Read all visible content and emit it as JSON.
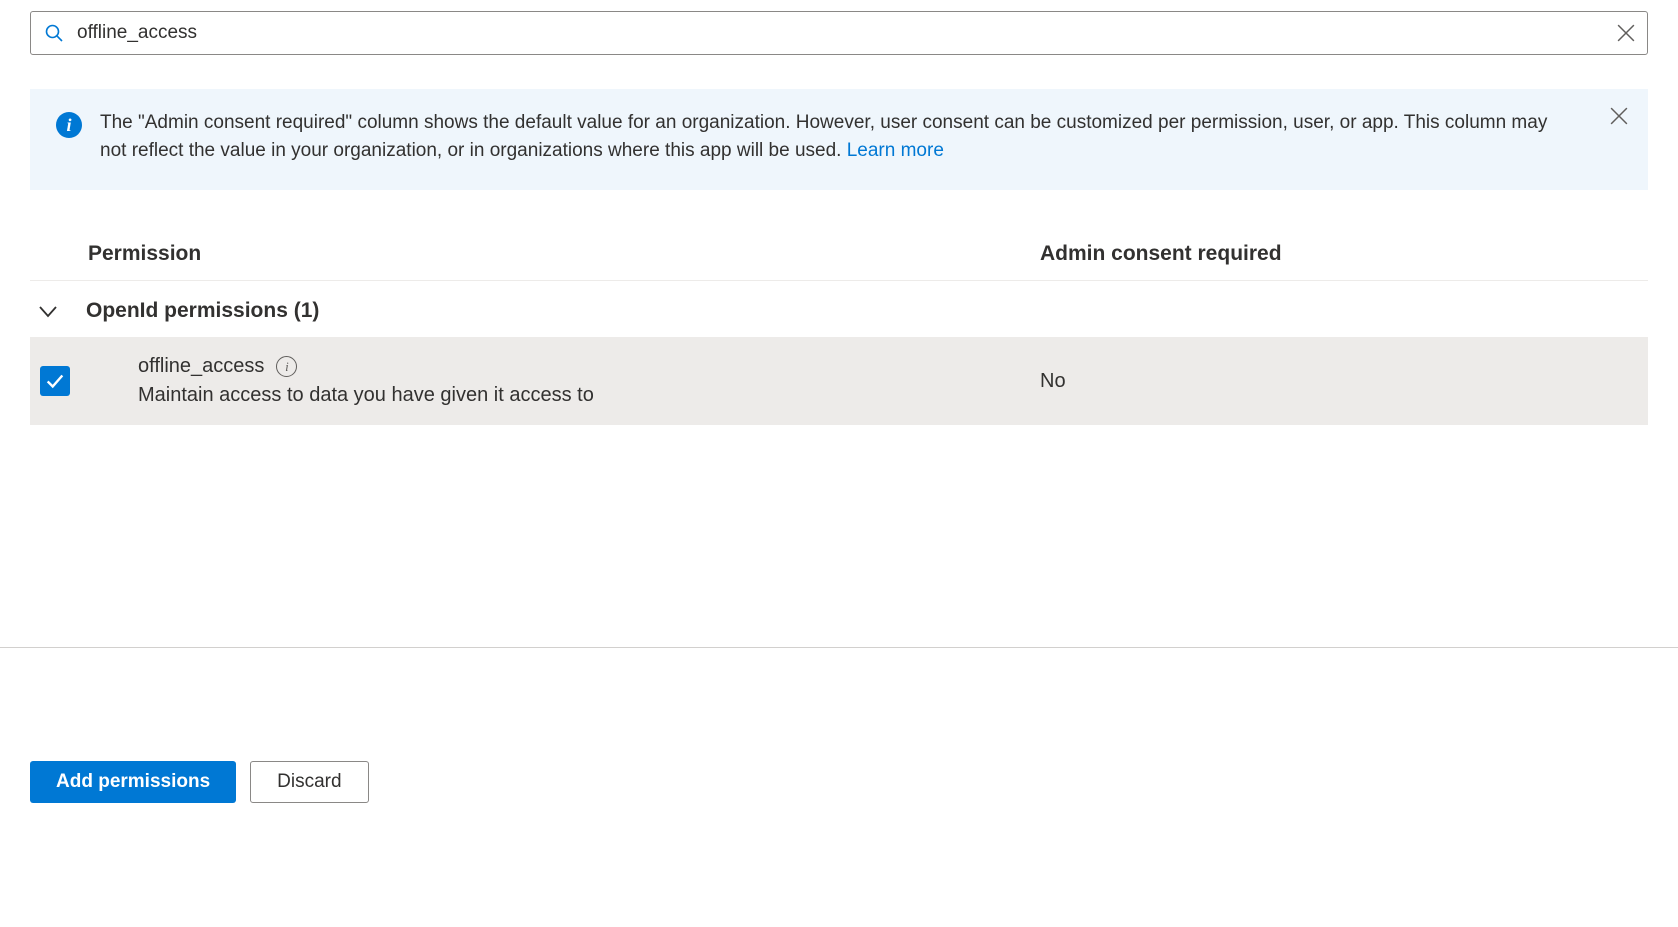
{
  "search": {
    "value": "offline_access"
  },
  "banner": {
    "text": "The \"Admin consent required\" column shows the default value for an organization. However, user consent can be customized per permission, user, or app. This column may not reflect the value in your organization, or in organizations where this app will be used.  ",
    "link_text": "Learn more"
  },
  "table": {
    "columns": {
      "permission": "Permission",
      "consent": "Admin consent required"
    },
    "group": {
      "label": "OpenId permissions (1)"
    },
    "rows": [
      {
        "name": "offline_access",
        "description": "Maintain access to data you have given it access to",
        "consent": "No",
        "checked": true
      }
    ]
  },
  "footer": {
    "primary": "Add permissions",
    "secondary": "Discard"
  }
}
